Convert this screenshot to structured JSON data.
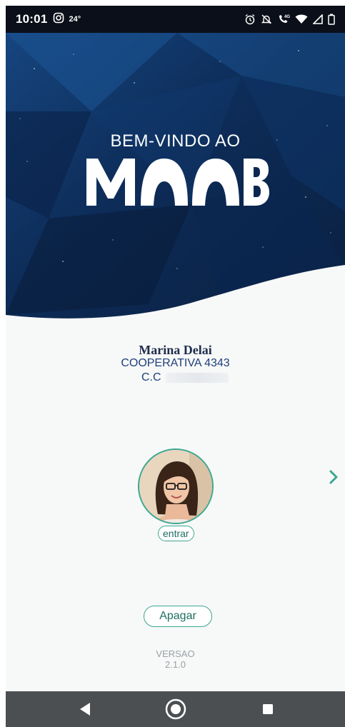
{
  "status_bar": {
    "time": "10:01",
    "temperature": "24°",
    "icons": [
      "instagram-icon",
      "alarm-icon",
      "notifications-off-icon",
      "wifi-call-icon",
      "4g-icon",
      "wifi-icon",
      "signal-icon",
      "battery-icon"
    ]
  },
  "hero": {
    "welcome_text": "BEM-VINDO AO",
    "brand": "MOOB"
  },
  "profile": {
    "name": "Marina Delai",
    "cooperative": "COOPERATIVA 4343",
    "account_label": "C.C"
  },
  "actions": {
    "enter_label": "entrar",
    "delete_label": "Apagar"
  },
  "footer": {
    "version_label": "VERSAO",
    "version_number": "2.1.0"
  },
  "colors": {
    "accent": "#3aa88f",
    "hero_dark": "#0d2c58",
    "text_primary": "#1f3f7a",
    "nav_bar": "#4b4f52"
  }
}
